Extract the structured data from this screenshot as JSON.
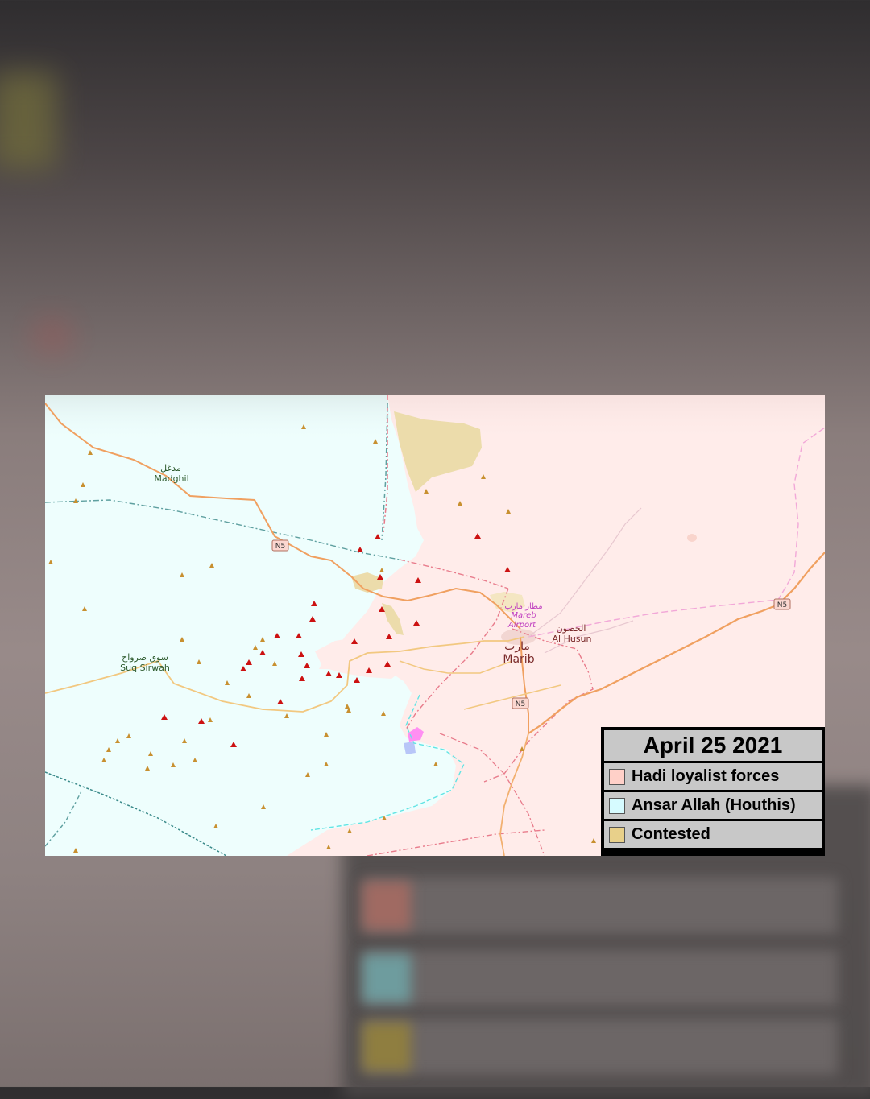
{
  "legend": {
    "title": "April 25 2021",
    "items": [
      {
        "label": "Hadi loyalist forces",
        "color": "#ffd0c8"
      },
      {
        "label": "Ansar Allah (Houthis)",
        "color": "#d6fbff"
      },
      {
        "label": "Contested",
        "color": "#e8d08a"
      }
    ]
  },
  "places": {
    "madghil_ar": "مدغل",
    "madghil": "Madghil",
    "suq_sirwah_ar": "سوق صرواح",
    "suq_sirwah": "Suq Sirwah",
    "airport_ar": "مطار مارب",
    "airport_1": "Mareb",
    "airport_2": "Airport",
    "husun_ar": "الحصون",
    "husun": "Al Husun",
    "marib_ar": "مارب",
    "marib": "Marib"
  },
  "roads": {
    "n5_west": "N5",
    "n5_center": "N5",
    "n5_east": "N5"
  },
  "colors": {
    "hadi_area": "#ffecea",
    "houthi_area": "#eefefd",
    "contested_area": "#ecdcab",
    "road": "#f0a060",
    "secondary_road": "#f2c880",
    "marker_red": "#cc1111",
    "marker_tan": "#c89030"
  }
}
